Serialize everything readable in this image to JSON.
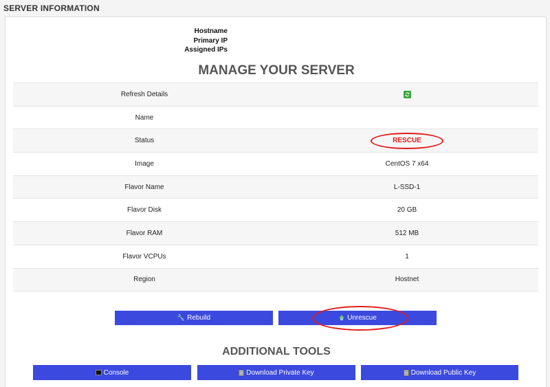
{
  "section_title": "SERVER INFORMATION",
  "host_info": {
    "hostname_label": "Hostname",
    "primary_ip_label": "Primary IP",
    "assigned_ips_label": "Assigned IPs"
  },
  "manage_title": "MANAGE YOUR SERVER",
  "details": {
    "refresh_label": "Refresh Details",
    "refresh_icon": "refresh-icon",
    "name_label": "Name",
    "name_value": "",
    "status_label": "Status",
    "status_value": "RESCUE",
    "image_label": "Image",
    "image_value": "CentOS 7 x64",
    "flavor_name_label": "Flavor Name",
    "flavor_name_value": "L-SSD-1",
    "flavor_disk_label": "Flavor Disk",
    "flavor_disk_value": "20 GB",
    "flavor_ram_label": "Flavor RAM",
    "flavor_ram_value": "512 MB",
    "flavor_vcpus_label": "Flavor VCPUs",
    "flavor_vcpus_value": "1",
    "region_label": "Region",
    "region_value": "Hostnet"
  },
  "actions": {
    "rebuild_label": "Rebuild",
    "unrescue_label": "Unrescue"
  },
  "tools_title": "ADDITIONAL TOOLS",
  "tools": {
    "console_label": "Console",
    "download_private_label": "Download Private Key",
    "download_public_label": "Download Public Key"
  },
  "colors": {
    "button": "#3b49df",
    "highlight": "#e31b1b",
    "refresh_icon": "#3aa53a"
  }
}
